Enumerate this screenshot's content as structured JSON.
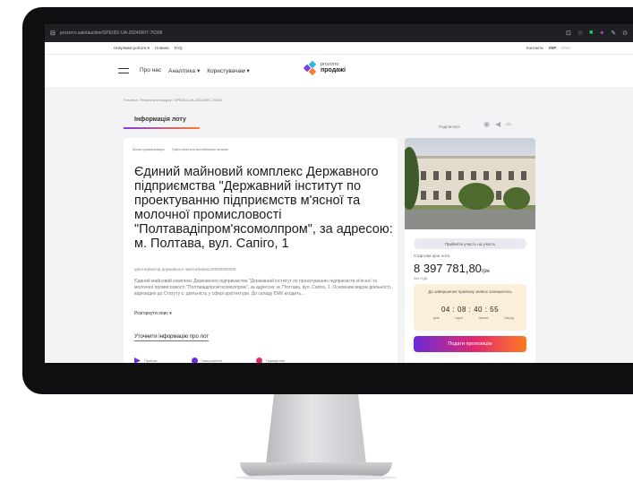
{
  "browser": {
    "url": "prozorro.sale/auction/SPE001-UA-20240607-76306",
    "icons": [
      "lock-icon",
      "translate-icon",
      "star-icon",
      "extension-icon",
      "puzzle-icon",
      "pen-icon",
      "profile-icon"
    ]
  },
  "topnav": {
    "left": [
      "Напрямки роботи ▾",
      "Новини",
      "FAQ"
    ],
    "right": [
      "Контакти",
      "УКР",
      "ENG"
    ]
  },
  "mainnav": {
    "links": [
      "Про нас",
      "Аналітика ▾",
      "Користувачам ▾"
    ],
    "logo_top": "prozorro",
    "logo_bottom": "продажі"
  },
  "breadcrumb": "Головна / Результати пошуку / SPE001-UA-20240607-76306",
  "tab_label": "Інформація лоту",
  "share_label": "Поділитися",
  "lot": {
    "badge_1": "Мала приватизація",
    "badge_2": "Транслюється англійською мовою",
    "title": "Єдиний майновий комплекс Державного підприємства \"Державний інститут по проектуванню підприємств м'ясної та молочної промисловості \"Полтавадіпром'ясомолпром\", за адресою: м. Полтава, вул. Сапіго, 1",
    "code": "ідентифікатор державного пакета/майна:00000000000",
    "description": "Єдиний майновий комплекс Державного підприємства \"Державний інститут по проектуванню підприємств м'ясної та молочної промисловості \"Полтавадіпром'ясомолпром\", за адресою: м. Полтава, вул. Сапіго, 1. Основним видом діяльності, відповідно до Статуту є: діяльність у сфері архітектури. До складу ЄМК входить...",
    "expand": "Розгорнути опис ▾",
    "clarify": "Уточнити інформацію про лот",
    "steps": [
      "Прийом",
      "Завершення",
      "Підведення"
    ]
  },
  "side": {
    "join": "Прийняти участь на участь",
    "start_label": "Стартова ціна лота",
    "price": "8 397 781,80",
    "currency": "грн",
    "vat": "без ПДВ",
    "timer_caption": "До завершення прийому заявок залишилось",
    "clock": "04 : 08 : 40 : 55",
    "units": [
      "днів",
      "годин",
      "хвилин",
      "секунд"
    ],
    "cta": "Подати пропозицію"
  },
  "colors": {
    "accent_purple": "#6b2bd9",
    "accent_orange": "#ff7a21",
    "timer_bg": "#fcefd9"
  }
}
